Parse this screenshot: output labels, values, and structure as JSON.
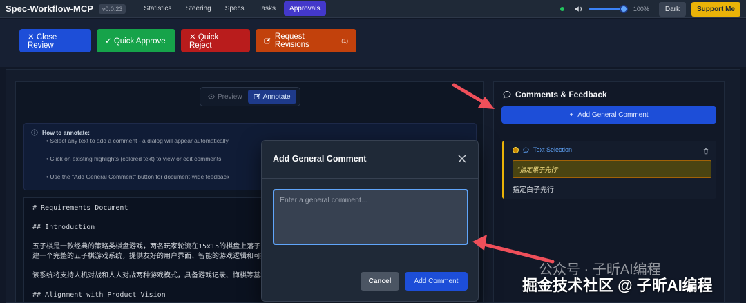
{
  "nav": {
    "brand": "Spec-Workflow-MCP",
    "version": "v0.0.23",
    "tabs": [
      {
        "label": "Statistics"
      },
      {
        "label": "Steering"
      },
      {
        "label": "Specs"
      },
      {
        "label": "Tasks"
      },
      {
        "label": "Approvals",
        "active": true
      }
    ],
    "volume_percent": 100,
    "volume_label": "100%",
    "theme_label": "Dark",
    "support_label": "Support Me"
  },
  "actions": {
    "close_review": "✕ Close Review",
    "quick_approve": "✓ Quick Approve",
    "quick_reject": "✕ Quick Reject",
    "request_revisions": "Request Revisions",
    "revisions_count": "(1)"
  },
  "view_toggle": {
    "preview": "Preview",
    "annotate": "Annotate"
  },
  "howto": {
    "title": "How to annotate:",
    "tips": [
      "• Select any text to add a comment - a dialog will appear automatically",
      "• Click on existing highlights (colored text) to view or edit comments",
      "• Use the \"Add General Comment\" button for document-wide feedback"
    ]
  },
  "document": {
    "lines": [
      "# Requirements Document",
      "",
      "## Introduction",
      "",
      "五子棋是一款经典的策略类棋盘游戏，两名玩家轮流在15x15的棋盘上落子，",
      "建一个完整的五子棋游戏系统，提供友好的用户界面、智能的游戏逻辑和可扩",
      "",
      "该系统将支持人机对战和人人对战两种游戏模式，具备游戏记录、悔棋等基本",
      "",
      "## Alignment with Product Vision"
    ]
  },
  "comments": {
    "title": "Comments & Feedback",
    "add_general": "Add General Comment",
    "items": [
      {
        "type": "Text Selection",
        "highlight_color": "#eab308",
        "quote": "\"指定黑子先行\"",
        "text": "指定白子先行"
      }
    ]
  },
  "modal": {
    "title": "Add General Comment",
    "placeholder": "Enter a general comment...",
    "value": "",
    "cancel": "Cancel",
    "submit": "Add Comment"
  },
  "watermark": {
    "account": "公众号 · 子昕AI编程",
    "site": "掘金技术社区 @ 子昕AI编程"
  },
  "colors": {
    "accent": "#4338ca",
    "primary": "#1d4ed8",
    "approve": "#16a34a",
    "reject": "#b91c1c",
    "revise": "#c2410c",
    "support": "#eab308",
    "annotation_arrow": "#ef4f5a"
  }
}
